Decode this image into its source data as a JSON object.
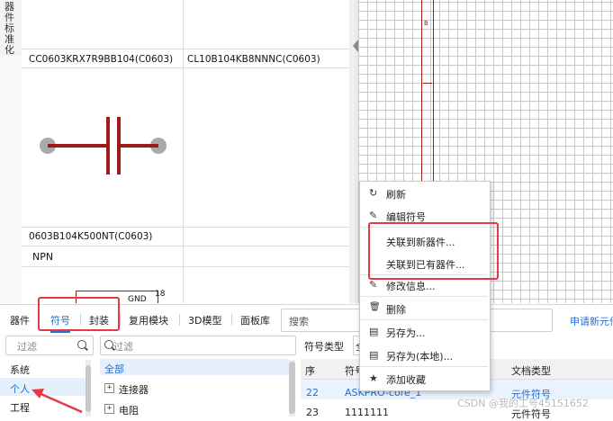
{
  "left_strip": {
    "vertical_label": "器件标准化"
  },
  "component_grid": {
    "cells": [
      {
        "caption": "CC0603KRX7R9BB104(C0603)"
      },
      {
        "caption": "CL10B104KB8NNNC(C0603)"
      },
      {
        "caption": "0603B104K500NT(C0603)"
      },
      {
        "caption": ""
      }
    ],
    "section_label": "NPN",
    "partial_labels": [
      "GND",
      "18"
    ]
  },
  "canvas": {
    "symbol_letter": "B"
  },
  "context_menu": {
    "items": [
      {
        "icon": "refresh-icon",
        "glyph": "↻",
        "label": "刷新"
      },
      {
        "icon": "edit-icon",
        "glyph": "✎",
        "label": "编辑符号"
      },
      {
        "icon": "",
        "glyph": "",
        "label": "关联到新器件..."
      },
      {
        "icon": "",
        "glyph": "",
        "label": "关联到已有器件..."
      },
      {
        "icon": "edit-icon",
        "glyph": "✎",
        "label": "修改信息..."
      },
      {
        "icon": "trash-icon",
        "glyph": "🗑",
        "label": "删除"
      },
      {
        "icon": "save-icon",
        "glyph": "▤",
        "label": "另存为..."
      },
      {
        "icon": "save-icon",
        "glyph": "▤",
        "label": "另存为(本地)..."
      },
      {
        "icon": "star-icon",
        "glyph": "★",
        "label": "添加收藏"
      }
    ]
  },
  "library": {
    "tabs": [
      "器件",
      "符号",
      "封装",
      "复用模块",
      "3D模型",
      "面板库"
    ],
    "active_tab": "符号",
    "search_placeholder": "搜索",
    "new_link": "申请新元件",
    "left_filter": "过滤",
    "mid_filter": "过滤",
    "categories": [
      "系统",
      "个人",
      "工程"
    ],
    "selected_category": "个人",
    "tree": [
      {
        "label": "全部",
        "expandable": false
      },
      {
        "label": "连接器",
        "expandable": true
      },
      {
        "label": "电阻",
        "expandable": true
      }
    ],
    "symbol_type_label": "符号类型",
    "symbol_type_value": "全",
    "table": {
      "columns": [
        "序",
        "符号",
        "文档类型"
      ],
      "rows": [
        {
          "no": "22",
          "symbol": "ASKPRO-core_1",
          "type": "元件符号"
        },
        {
          "no": "23",
          "symbol": "1111111",
          "type": "元件符号"
        }
      ]
    }
  },
  "watermark": "CSDN @我的工号45151652",
  "colors": {
    "accent": "#1f6fd6",
    "highlight": "#e53946",
    "symbol": "#9b1a1a"
  }
}
